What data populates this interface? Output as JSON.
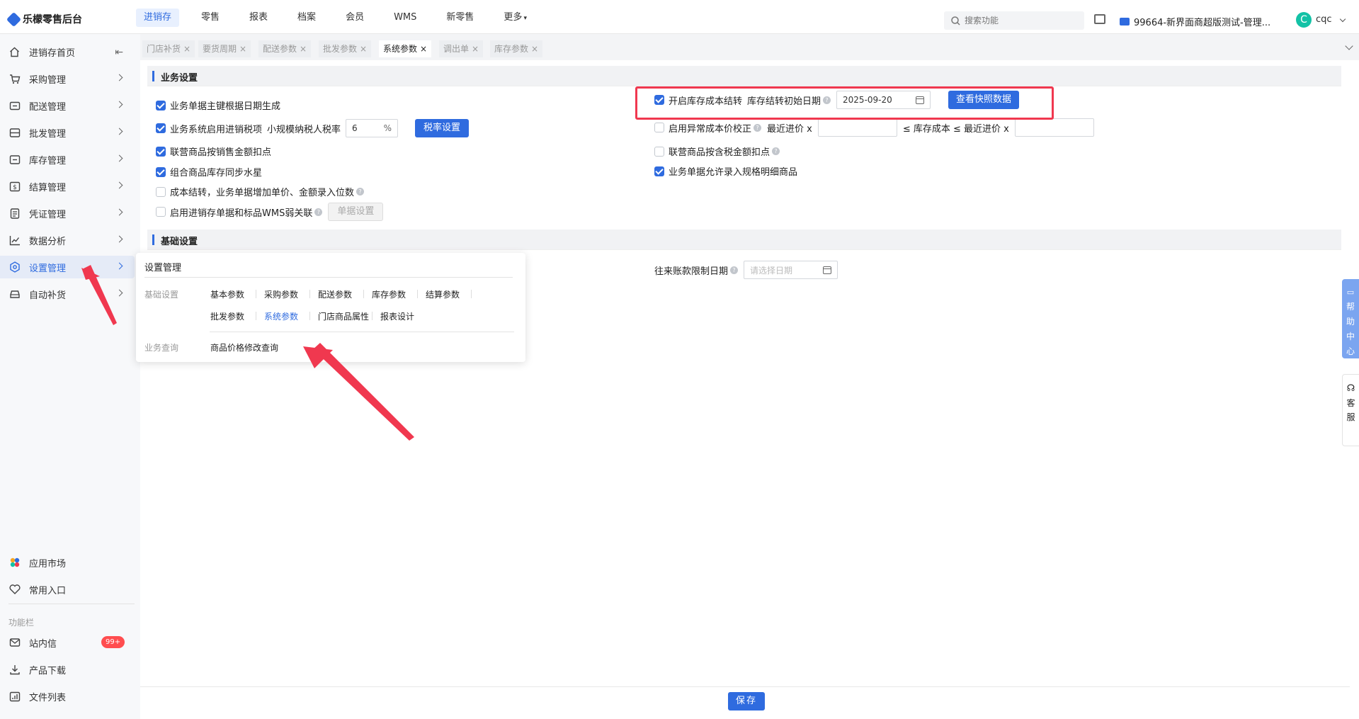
{
  "app": {
    "title": "乐檬零售后台"
  },
  "topnav": {
    "items": [
      "进销存",
      "零售",
      "报表",
      "档案",
      "会员",
      "WMS",
      "新零售",
      "更多"
    ],
    "active_index": 0
  },
  "search": {
    "placeholder": "搜索功能"
  },
  "store": {
    "name": "99664-新界面商超版测试-管理..."
  },
  "user": {
    "avatar_letter": "C",
    "name": "cqc"
  },
  "sidebar": {
    "items": [
      {
        "label": "进销存首页",
        "icon": "home-icon"
      },
      {
        "label": "采购管理",
        "icon": "cart-icon"
      },
      {
        "label": "配送管理",
        "icon": "truck-icon"
      },
      {
        "label": "批发管理",
        "icon": "box-icon"
      },
      {
        "label": "库存管理",
        "icon": "inventory-icon"
      },
      {
        "label": "结算管理",
        "icon": "dollar-icon"
      },
      {
        "label": "凭证管理",
        "icon": "document-icon"
      },
      {
        "label": "数据分析",
        "icon": "chart-icon"
      },
      {
        "label": "设置管理",
        "icon": "settings-icon"
      },
      {
        "label": "自动补货",
        "icon": "car-icon"
      }
    ],
    "active_index": 8,
    "bottom": {
      "app_market": "应用市场",
      "favorites": "常用入口",
      "section_label": "功能栏",
      "messages": "站内信",
      "messages_badge": "99+",
      "downloads": "产品下载",
      "files": "文件列表"
    }
  },
  "tabs": {
    "items": [
      "门店补货",
      "要货周期",
      "配送参数",
      "批发参数",
      "系统参数",
      "调出单",
      "库存参数"
    ],
    "active_index": 4,
    "close": "×"
  },
  "business_settings": {
    "title": "业务设置",
    "left": {
      "r1": {
        "label": "业务单据主键根据日期生成",
        "checked": true
      },
      "r2": {
        "label": "业务系统启用进销税项",
        "checked": true,
        "rate_label": "小规模纳税人税率",
        "rate_value": "6",
        "rate_unit": "%",
        "button": "税率设置"
      },
      "r3": {
        "label": "联营商品按销售金额扣点",
        "checked": true
      },
      "r4": {
        "label": "组合商品库存同步水星",
        "checked": true
      },
      "r5": {
        "label": "成本结转，业务单据增加单价、金额录入位数",
        "checked": false
      },
      "r6": {
        "label": "启用进销存单据和标品WMS弱关联",
        "checked": false,
        "button": "单据设置"
      }
    },
    "right": {
      "r1": {
        "label": "开启库存成本结转",
        "checked": true,
        "date_label": "库存结转初始日期",
        "date_value": "2025-09-20",
        "button": "查看快照数据"
      },
      "r2": {
        "label": "启用异常成本价校正",
        "checked": false,
        "lower_label": "最近进价 x",
        "middle_label": "≤ 库存成本 ≤ 最近进价 x"
      },
      "r3": {
        "label": "联营商品按含税金额扣点",
        "checked": false
      },
      "r4": {
        "label": "业务单据允许录入规格明细商品",
        "checked": true
      }
    }
  },
  "basic_settings": {
    "title": "基础设置",
    "ar_limit_label": "往来账款限制日期",
    "ar_limit_placeholder": "请选择日期"
  },
  "flyout": {
    "title": "设置管理",
    "basic_label": "基础设置",
    "basic_links_row1": [
      "基本参数",
      "采购参数",
      "配送参数",
      "库存参数",
      "结算参数"
    ],
    "basic_links_row2": [
      "批发参数",
      "系统参数",
      "门店商品属性",
      "报表设计"
    ],
    "active_link": "系统参数",
    "query_label": "业务查询",
    "query_links": [
      "商品价格修改查询"
    ]
  },
  "floating": {
    "help_center": [
      "帮",
      "助",
      "中",
      "心"
    ],
    "service": [
      "客",
      "服"
    ]
  },
  "footer": {
    "save": "保存"
  },
  "colors": {
    "primary": "#2f6bdf",
    "highlight": "#f0384f",
    "badge": "#ff4d4f"
  }
}
